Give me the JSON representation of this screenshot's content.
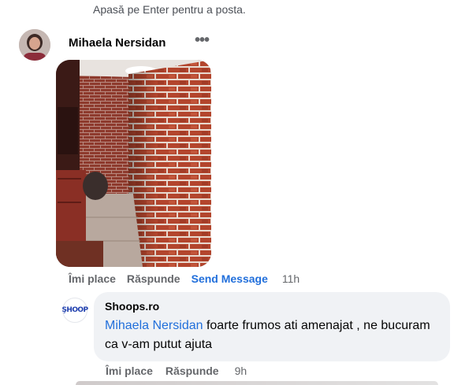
{
  "composer": {
    "hint": "Apasă pe Enter pentru a posta."
  },
  "comment": {
    "author": "Mihaela Nersidan",
    "more_icon": "more-horizontal-icon",
    "like_label": "Îmi place",
    "reply_label": "Răspunde",
    "send_message_label": "Send Message",
    "time": "11h"
  },
  "reply": {
    "author": "Shoops.ro",
    "avatar_text": "ŞHOOP",
    "mention": "Mihaela Nersidan",
    "text": " foarte frumos ati amenajat , ne bucuram ca v-am putut ajuta",
    "like_label": "Îmi place",
    "reply_label": "Răspunde",
    "time": "9h"
  },
  "colors": {
    "link": "#216fdb",
    "muted": "#65676b",
    "bubble": "#f0f2f5",
    "brick": "#9c3b2a"
  }
}
